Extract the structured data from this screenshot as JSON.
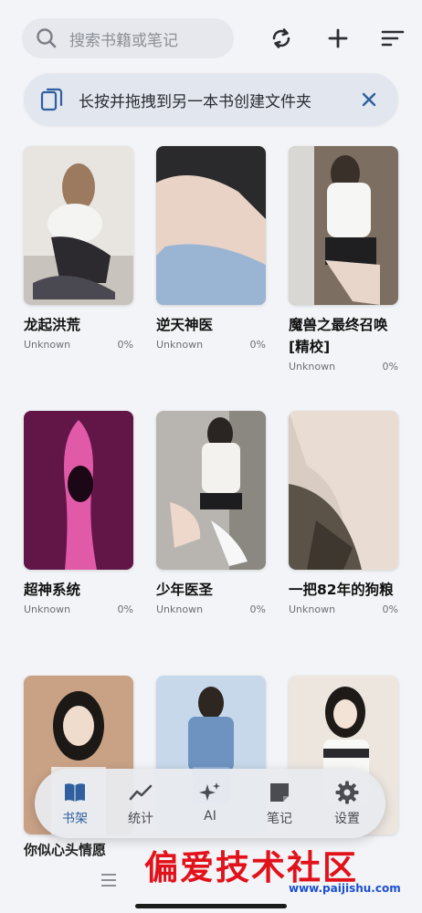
{
  "search": {
    "placeholder": "搜索书籍或笔记"
  },
  "banner": {
    "text": "长按并拖拽到另一本书创建文件夹"
  },
  "books": [
    {
      "title": "龙起洪荒",
      "author": "Unknown",
      "progress": "0%"
    },
    {
      "title": "逆天神医",
      "author": "Unknown",
      "progress": "0%"
    },
    {
      "title": "魔兽之最终召唤[精校]",
      "author": "Unknown",
      "progress": "0%"
    },
    {
      "title": "超神系统",
      "author": "Unknown",
      "progress": "0%"
    },
    {
      "title": "少年医圣",
      "author": "Unknown",
      "progress": "0%"
    },
    {
      "title": "一把82年的狗粮",
      "author": "Unknown",
      "progress": "0%"
    }
  ],
  "partial_row": {
    "title_peek": "你似心头情愿"
  },
  "nav": {
    "items": [
      {
        "label": "书架",
        "icon": "bookshelf-icon"
      },
      {
        "label": "统计",
        "icon": "trend-chart-icon"
      },
      {
        "label": "AI",
        "icon": "sparkle-icon"
      },
      {
        "label": "笔记",
        "icon": "note-icon"
      },
      {
        "label": "设置",
        "icon": "gear-icon"
      }
    ],
    "active": "书架"
  },
  "watermark": {
    "text": "偏爱技术社区",
    "url": "www.paijishu.com"
  },
  "colors": {
    "accent": "#2f5f9e",
    "background": "#f3f4f7",
    "watermark": "#e2121b"
  }
}
